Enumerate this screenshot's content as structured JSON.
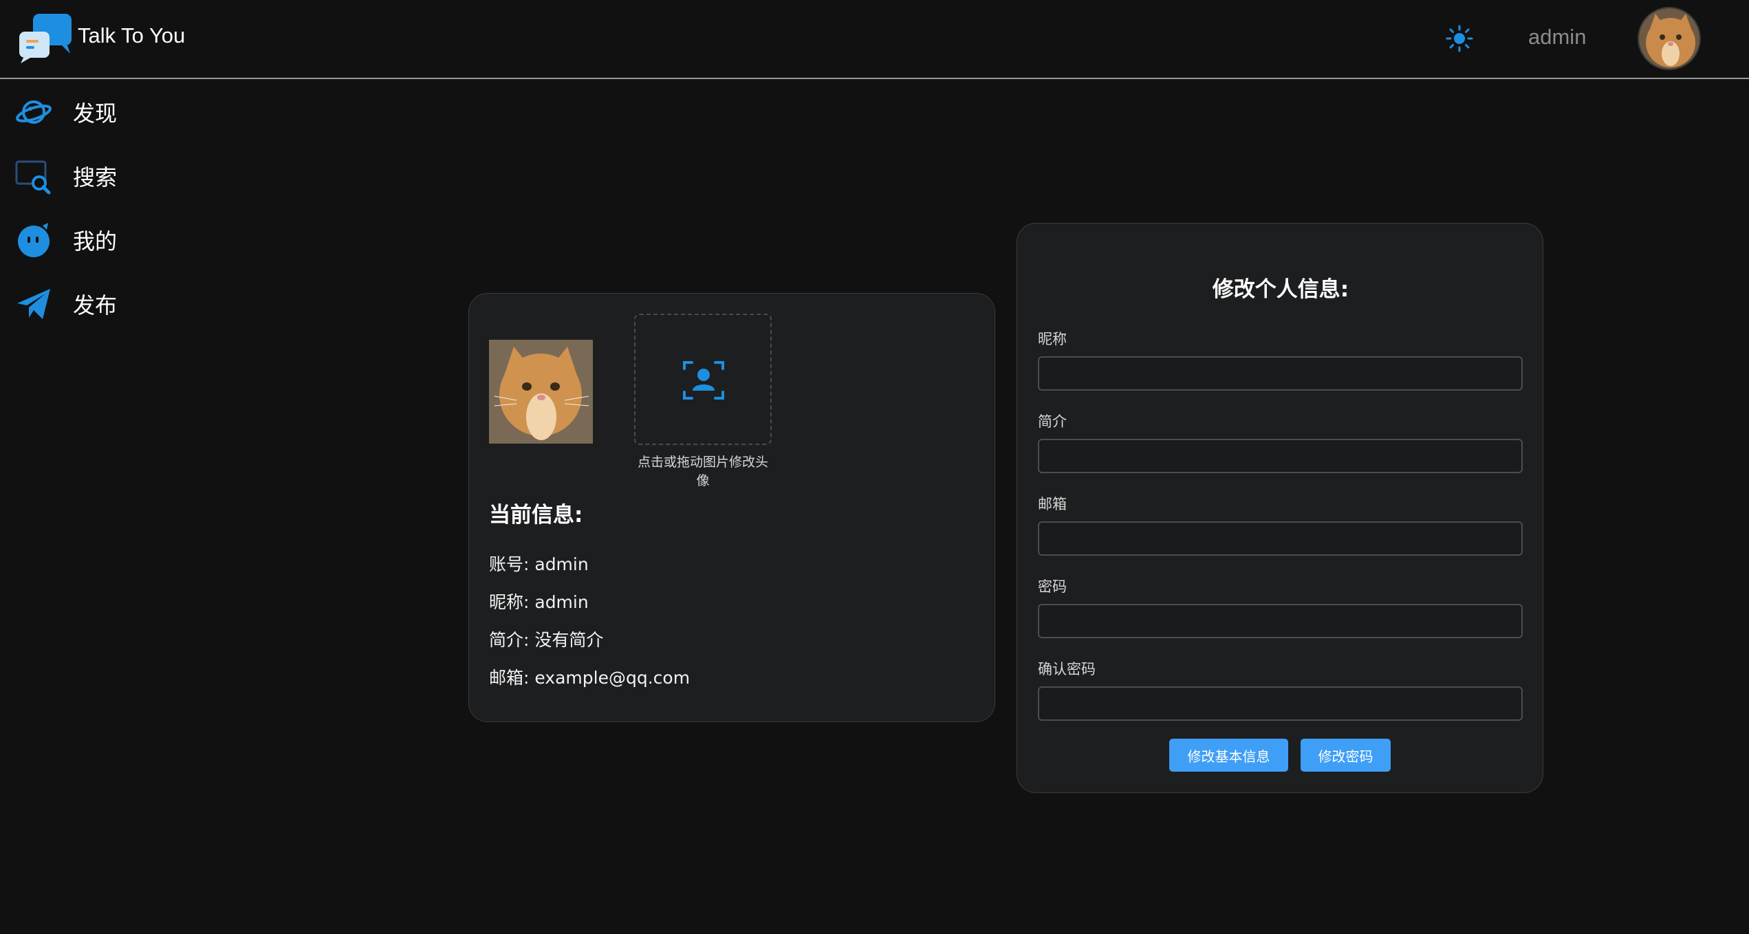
{
  "app": {
    "title": "Talk To You"
  },
  "header": {
    "username": "admin",
    "theme_icon": "sun-icon"
  },
  "sidebar": {
    "items": [
      {
        "label": "发现",
        "icon": "planet-icon"
      },
      {
        "label": "搜索",
        "icon": "search-icon"
      },
      {
        "label": "我的",
        "icon": "face-icon"
      },
      {
        "label": "发布",
        "icon": "paper-plane-icon"
      }
    ]
  },
  "profile": {
    "upload_hint": "点击或拖动图片修改头像",
    "info_title": "当前信息:",
    "lines": [
      "账号: admin",
      "昵称: admin",
      "简介: 没有简介",
      "邮箱: example@qq.com"
    ]
  },
  "form": {
    "title": "修改个人信息:",
    "fields": [
      {
        "label": "昵称",
        "value": ""
      },
      {
        "label": "简介",
        "value": ""
      },
      {
        "label": "邮箱",
        "value": ""
      },
      {
        "label": "密码",
        "value": ""
      },
      {
        "label": "确认密码",
        "value": ""
      }
    ],
    "submit_basic": "修改基本信息",
    "submit_password": "修改密码"
  },
  "colors": {
    "accent": "#3f9ef6",
    "icon_blue": "#1e8fe0",
    "background": "#111112",
    "card": "#1d1e20"
  }
}
